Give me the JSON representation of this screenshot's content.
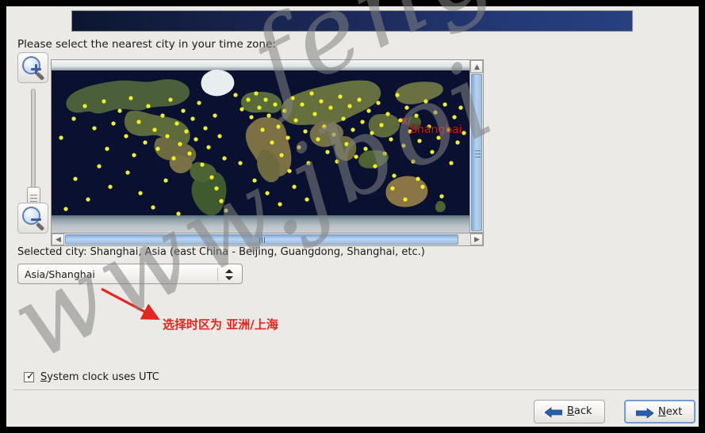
{
  "window": {
    "banner_title": ""
  },
  "prompt": {
    "text": "Please select the nearest city in your time zone:"
  },
  "map": {
    "marker_city": "Shanghai",
    "marker_symbol": "x",
    "ocean_color": "#0a1130",
    "city_dot_color": "#f2f21a",
    "marker_color": "#d80f0f"
  },
  "zoom_controls": {
    "zoom_in_icon": "magnifier-plus-icon",
    "zoom_out_icon": "magnifier-minus-icon",
    "slider_value": "min"
  },
  "scrollbars": {
    "vertical_up_glyph": "▲",
    "vertical_down_glyph": "▼",
    "horizontal_left_glyph": "◀",
    "horizontal_right_glyph": "▶"
  },
  "selection": {
    "selected_city_text": "Selected city: Shanghai, Asia (east China - Beijing, Guangdong, Shanghai, etc.)",
    "timezone_value": "Asia/Shanghai"
  },
  "annotation": {
    "text": "选择时区为 亚洲/上海",
    "color": "#e8251c"
  },
  "options": {
    "utc_checkbox_label_mnemonic": "S",
    "utc_checkbox_label_rest": "ystem clock uses UTC",
    "utc_checkbox_checked_glyph": "✓"
  },
  "buttons": {
    "back_mnemonic": "B",
    "back_label_rest": "ack",
    "next_mnemonic": "N",
    "next_label_rest": "ext",
    "arrow_color": "#2a5fb0"
  },
  "watermark": {
    "line1": "www.jboi",
    "line2": "feng"
  }
}
